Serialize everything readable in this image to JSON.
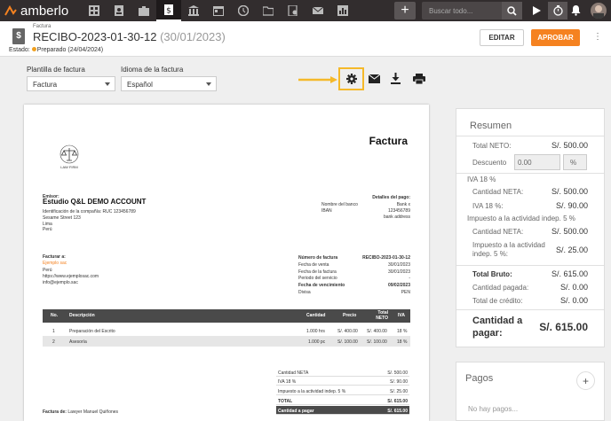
{
  "app": {
    "name": "amberlo"
  },
  "topbar": {
    "search_placeholder": "Buscar todo...",
    "nav_icons": [
      "dashboard-icon",
      "contacts-icon",
      "cases-icon",
      "billing-icon",
      "bank-icon",
      "calendar-icon",
      "time-icon",
      "folder-icon",
      "documents-icon",
      "mail-icon",
      "reports-icon"
    ]
  },
  "header": {
    "breadcrumb": "Factura",
    "title": "RECIBO-2023-01-30-12",
    "title_date": "(30/01/2023)",
    "status_label": "Estado:",
    "status_value": "Preparado (24/04/2024)",
    "edit_label": "EDITAR",
    "approve_label": "APROBAR"
  },
  "filters": {
    "template_label": "Plantilla de factura",
    "template_value": "Factura",
    "language_label": "Idioma de la factura",
    "language_value": "Español"
  },
  "invoice": {
    "title": "Factura",
    "logo_text": "LAW FIRM",
    "issuer_label": "Emisor:",
    "issuer_name": "Estudio Q&L DEMO ACCOUNT",
    "issuer_lines": [
      "Identificación de la compañía: RUC 123456789",
      "Sesame Street 123",
      "Lima",
      "Perú"
    ],
    "payment_title": "Detalles del pago:",
    "bank_rows": [
      [
        "Nombre del banco",
        "Bank x"
      ],
      [
        "IBAN",
        "123456789"
      ],
      [
        "",
        "bank address"
      ]
    ],
    "billto_label": "Facturar a:",
    "billto_name": "Ejemplo sac",
    "billto_lines": [
      "Perú",
      "https://www.ejemplosac.com",
      "info@ejemplo.sac"
    ],
    "meta_rows": [
      [
        "Número de factura",
        "RECIBO-2023-01-30-12"
      ],
      [
        "Fecha de venta",
        "30/01/2023"
      ],
      [
        "Fecha de la factura",
        "30/01/2023"
      ],
      [
        "Periodo del servicio",
        "-"
      ],
      [
        "Fecha de vencimiento",
        "09/02/2023"
      ],
      [
        "Divisa",
        "PEN"
      ]
    ],
    "table_headers": [
      "No.",
      "Descripción",
      "Cantidad",
      "Precio",
      "Total NETO",
      "IVA"
    ],
    "table_rows": [
      [
        "1",
        "Preparación del Escrito",
        "1.000 hrs",
        "S/. 400.00",
        "S/. 400.00",
        "18 %"
      ],
      [
        "2",
        "Asesoría",
        "1.000 pc",
        "S/. 100.00",
        "S/. 100.00",
        "18 %"
      ]
    ],
    "totals": [
      [
        "Cantidad NETA",
        "S/. 500.00"
      ],
      [
        "IVA 18 %",
        "S/. 90.00"
      ],
      [
        "Impuesto a la actividad indep. 5 %",
        "S/. 25.00"
      ],
      [
        "TOTAL",
        "S/. 615.00"
      ],
      [
        "Cantidad a pagar",
        "S/. 615.00"
      ]
    ],
    "invoiced_by_label": "Factura de:",
    "invoiced_by_name": "Lawyer Manuel Quiñones"
  },
  "summary": {
    "title": "Resumen",
    "total_neto_label": "Total NETO:",
    "total_neto_value": "S/. 500.00",
    "discount_label": "Descuento",
    "discount_value": "0.00",
    "discount_unit": "%",
    "iva_title": "IVA 18 %",
    "iva_neta_label": "Cantidad NETA:",
    "iva_neta_value": "S/. 500.00",
    "iva_label": "IVA 18 %:",
    "iva_value": "S/. 90.00",
    "tax_title": "Impuesto a la actividad indep. 5 %",
    "tax_neta_label": "Cantidad NETA:",
    "tax_neta_value": "S/. 500.00",
    "tax_label": "Impuesto a la actividad indep. 5 %:",
    "tax_value": "S/. 25.00",
    "gross_label": "Total Bruto:",
    "gross_value": "S/. 615.00",
    "paid_label": "Cantidad pagada:",
    "paid_value": "S/. 0.00",
    "credit_label": "Total de crédito:",
    "credit_value": "S/. 0.00",
    "due_label": "Cantidad a pagar:",
    "due_value": "S/. 615.00"
  },
  "payments": {
    "title": "Pagos",
    "add_label": "+",
    "empty_text": "No hay pagos..."
  },
  "colors": {
    "accent": "#f58220",
    "topbar": "#322d2e",
    "highlight": "#f5b92a"
  }
}
